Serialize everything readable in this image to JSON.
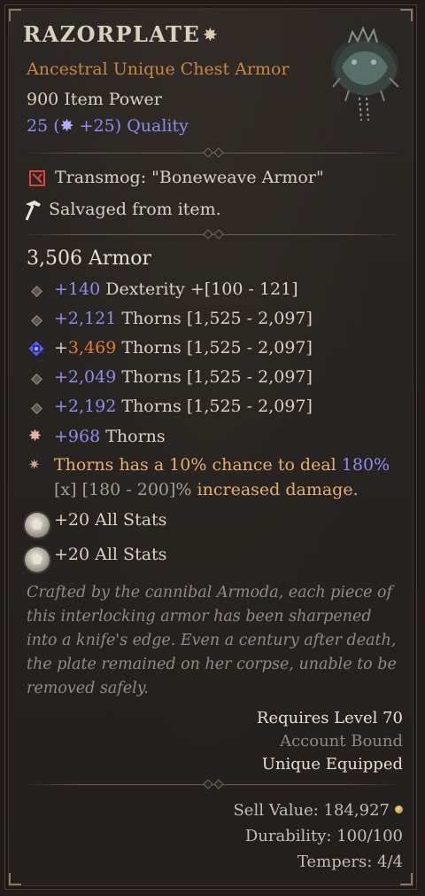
{
  "item": {
    "name": "RAZORPLATE",
    "subtitle": "Ancestral Unique Chest Armor",
    "item_power": "900 Item Power",
    "quality": {
      "base": "25",
      "open": "(",
      "bonus": "+25)",
      "label": "Quality"
    }
  },
  "info": {
    "transmog": "Transmog: \"Boneweave Armor\"",
    "salvaged": "Salvaged from item."
  },
  "armor": "3,506 Armor",
  "affixes": [
    {
      "value": "+140",
      "text": " Dexterity +[100 - 121]"
    },
    {
      "value": "+2,121",
      "text": " Thorns [1,525 - 2,097]"
    },
    {
      "prefix": "+",
      "value": "3,469",
      "text": " Thorns [1,525 - 2,097]"
    },
    {
      "value": "+2,049",
      "text": " Thorns [1,525 - 2,097]"
    },
    {
      "value": "+2,192",
      "text": " Thorns [1,525 - 2,097]"
    }
  ],
  "implicit": {
    "value": "+968",
    "text": " Thorns"
  },
  "unique_power": {
    "line1_a": "Thorns has a 10% chance to deal ",
    "line1_b": "180%",
    "line2_a": "[x] [180 - 200]%",
    "line2_b": " increased damage."
  },
  "sockets": [
    {
      "text": "+20 All Stats"
    },
    {
      "text": "+20 All Stats"
    }
  ],
  "flavor": "Crafted by the cannibal Armoda, each piece of this interlocking armor has been sharpened into a knife's edge. Even a century after death, the plate remained on her corpse, unable to be removed safely.",
  "requirements": {
    "level": "Requires Level 70",
    "bound": "Account Bound",
    "unique": "Unique Equipped"
  },
  "footer": {
    "sell": "Sell Value: 184,927",
    "durability": "Durability: 100/100",
    "tempers": "Tempers: 4/4"
  },
  "colors": {
    "unique_orange": "#c7873f",
    "magic_blue": "#8f8cf0",
    "greater_orange": "#e07a3a",
    "legendary_text": "#e5ad72"
  },
  "icons": [
    "unique-star-icon",
    "quality-spark-icon",
    "transmog-icon",
    "hammer-icon",
    "affix-bullet-icon",
    "greater-affix-icon",
    "implicit-star-icon",
    "legendary-power-icon",
    "socket-gem-icon",
    "gold-coin-icon"
  ]
}
